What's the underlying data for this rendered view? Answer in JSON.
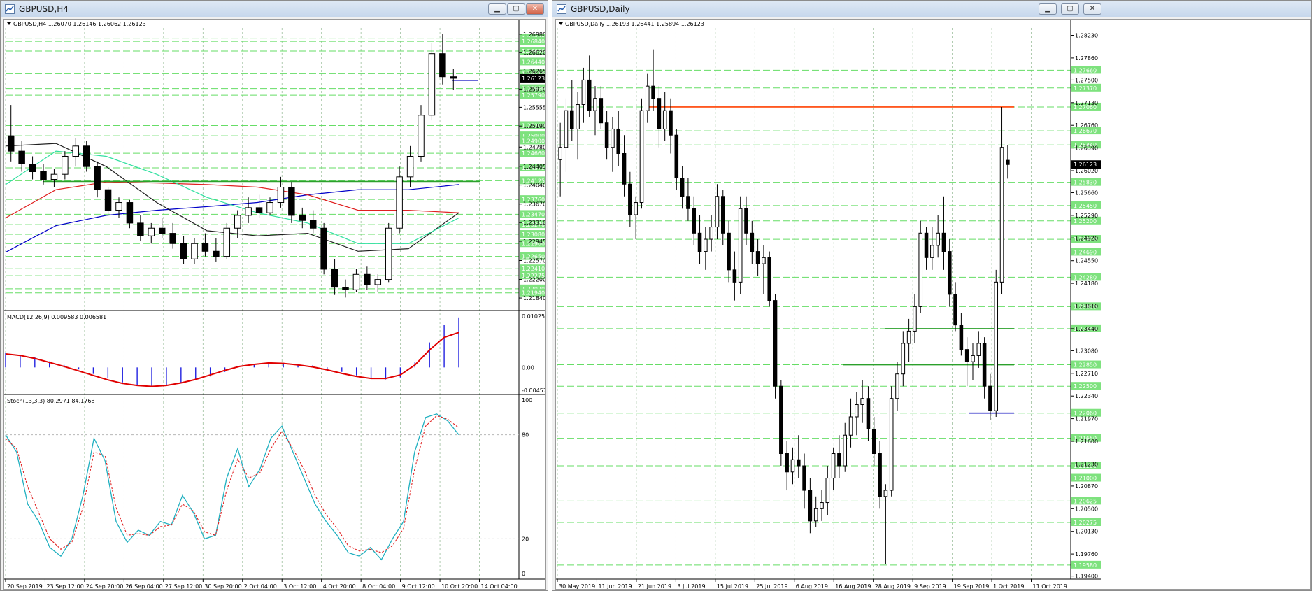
{
  "windows": {
    "h4": {
      "title": "GBPUSD,H4",
      "buttons": [
        "minimize",
        "maximize",
        "close"
      ]
    },
    "daily": {
      "title": "GBPUSD,Daily",
      "buttons": [
        "minimize",
        "maximize",
        "close"
      ]
    }
  },
  "chart_data": [
    {
      "id": "h4",
      "type": "candlestick",
      "symbol": "GBPUSD",
      "timeframe": "H4",
      "header": "GBPUSD,H4  1.26070 1.26146 1.26062 1.26123",
      "ohlc_last": [
        1.2607,
        1.26146,
        1.26062,
        1.26123
      ],
      "ylim": [
        1.2165,
        1.271
      ],
      "ytick_labels": [
        "1.26980",
        "1.26620",
        "1.26265",
        "1.25910",
        "1.25555",
        "1.25190",
        "1.24780",
        "1.24405",
        "1.24040",
        "1.23670",
        "1.23310",
        "1.22945",
        "1.22570",
        "1.22200",
        "1.21840"
      ],
      "level_labels": [
        "1.26900",
        "1.26840",
        "1.26650",
        "1.26440",
        "1.26210",
        "1.25920",
        "1.25790",
        "1.25200",
        "1.25000",
        "1.24900",
        "1.24660",
        "1.24375",
        "1.24125",
        "1.23760",
        "1.23470",
        "1.23270",
        "1.23080",
        "1.22900",
        "1.22650",
        "1.22410",
        "1.22275",
        "1.22020",
        "1.21940"
      ],
      "current_price_label": "1.26123",
      "x_labels": [
        "20 Sep 2019",
        "23 Sep 12:00",
        "24 Sep 20:00",
        "26 Sep 04:00",
        "27 Sep 12:00",
        "30 Sep 20:00",
        "2 Oct 04:00",
        "3 Oct 12:00",
        "4 Oct 20:00",
        "8 Oct 04:00",
        "9 Oct 12:00",
        "10 Oct 20:00",
        "14 Oct 04:00"
      ],
      "horizontal_lines": [
        {
          "price": 1.2411,
          "color": "#2ca02c"
        },
        {
          "price": 1.2608,
          "color": "#1010c0"
        }
      ],
      "moving_averages": [
        {
          "color": "#0000c8",
          "values": [
            1.2273,
            1.2325,
            1.2345,
            1.2355,
            1.2362,
            1.237,
            1.2385,
            1.2395,
            1.2395,
            1.2405
          ]
        },
        {
          "color": "#e02020",
          "values": [
            1.234,
            1.2395,
            1.241,
            1.2408,
            1.2405,
            1.24,
            1.2385,
            1.2355,
            1.2355,
            1.235
          ]
        },
        {
          "color": "#202020",
          "values": [
            1.248,
            1.2485,
            1.244,
            1.237,
            1.2315,
            1.2305,
            1.231,
            1.2275,
            1.228,
            1.235
          ]
        },
        {
          "color": "#30e0a0",
          "values": [
            1.2405,
            1.247,
            1.246,
            1.2425,
            1.238,
            1.235,
            1.233,
            1.229,
            1.229,
            1.234
          ]
        }
      ],
      "macd": {
        "label": "MACD(12,26,9) 0.009583 0.006581",
        "ytick_labels": [
          "0.010257",
          "0.00",
          "-0.00457"
        ],
        "ylim": [
          -0.00457,
          0.010257
        ],
        "histogram": [
          0.0029,
          0.0025,
          0.002,
          0.0012,
          0.0005,
          -0.0004,
          -0.0013,
          -0.0022,
          -0.003,
          -0.0036,
          -0.0038,
          -0.0036,
          -0.0032,
          -0.0026,
          -0.0018,
          -0.0009,
          0.0,
          0.0005,
          0.0009,
          0.0009,
          0.0007,
          0.0004,
          -0.0002,
          -0.0009,
          -0.0016,
          -0.0022,
          -0.0024,
          -0.002,
          0.001,
          0.005,
          0.0085,
          0.01
        ],
        "signal": [
          0.0027,
          0.0024,
          0.0018,
          0.001,
          0.0002,
          -0.0007,
          -0.0016,
          -0.0025,
          -0.0032,
          -0.0036,
          -0.0038,
          -0.0036,
          -0.0031,
          -0.0024,
          -0.0015,
          -0.0006,
          0.0002,
          0.0006,
          0.0009,
          0.0008,
          0.0005,
          0.0001,
          -0.0005,
          -0.0012,
          -0.0018,
          -0.0022,
          -0.0022,
          -0.0015,
          0.0005,
          0.0035,
          0.006,
          0.007
        ]
      },
      "stochastic": {
        "label": "Stoch(13,3,3) 80.2971 84.1768",
        "ytick_labels": [
          "100",
          "80",
          "20",
          "0"
        ],
        "ylim": [
          0,
          100
        ],
        "k": [
          80,
          70,
          40,
          30,
          15,
          10,
          20,
          45,
          78,
          65,
          30,
          18,
          25,
          22,
          30,
          28,
          45,
          35,
          20,
          22,
          55,
          72,
          50,
          60,
          78,
          85,
          70,
          55,
          40,
          30,
          22,
          12,
          10,
          15,
          8,
          20,
          30,
          70,
          90,
          92,
          88,
          80
        ],
        "d": [
          78,
          72,
          50,
          35,
          20,
          14,
          18,
          38,
          70,
          68,
          38,
          22,
          23,
          22,
          27,
          28,
          40,
          36,
          24,
          22,
          48,
          66,
          55,
          58,
          72,
          82,
          72,
          60,
          45,
          34,
          26,
          16,
          13,
          14,
          12,
          16,
          26,
          60,
          85,
          91,
          89,
          84
        ]
      },
      "ohlc": [
        [
          1.25,
          1.256,
          1.245,
          1.247
        ],
        [
          1.247,
          1.249,
          1.243,
          1.2445
        ],
        [
          1.2445,
          1.246,
          1.2415,
          1.243
        ],
        [
          1.243,
          1.2445,
          1.2405,
          1.2415
        ],
        [
          1.2415,
          1.2435,
          1.24,
          1.2425
        ],
        [
          1.2425,
          1.247,
          1.2415,
          1.246
        ],
        [
          1.246,
          1.2495,
          1.244,
          1.248
        ],
        [
          1.248,
          1.249,
          1.243,
          1.244
        ],
        [
          1.244,
          1.245,
          1.238,
          1.2395
        ],
        [
          1.2395,
          1.24,
          1.2345,
          1.2355
        ],
        [
          1.2355,
          1.238,
          1.234,
          1.237
        ],
        [
          1.237,
          1.2375,
          1.232,
          1.233
        ],
        [
          1.233,
          1.2345,
          1.2295,
          1.2305
        ],
        [
          1.2305,
          1.233,
          1.229,
          1.232
        ],
        [
          1.232,
          1.234,
          1.23,
          1.231
        ],
        [
          1.231,
          1.233,
          1.228,
          1.229
        ],
        [
          1.229,
          1.2305,
          1.225,
          1.226
        ],
        [
          1.226,
          1.23,
          1.225,
          1.229
        ],
        [
          1.229,
          1.231,
          1.2265,
          1.2275
        ],
        [
          1.2275,
          1.23,
          1.2255,
          1.2265
        ],
        [
          1.2265,
          1.233,
          1.226,
          1.232
        ],
        [
          1.232,
          1.2355,
          1.23,
          1.2345
        ],
        [
          1.2345,
          1.238,
          1.233,
          1.236
        ],
        [
          1.236,
          1.2385,
          1.234,
          1.235
        ],
        [
          1.235,
          1.238,
          1.2345,
          1.237
        ],
        [
          1.237,
          1.242,
          1.236,
          1.24
        ],
        [
          1.24,
          1.241,
          1.233,
          1.2345
        ],
        [
          1.2345,
          1.236,
          1.232,
          1.2335
        ],
        [
          1.2335,
          1.2355,
          1.231,
          1.232
        ],
        [
          1.232,
          1.233,
          1.223,
          1.224
        ],
        [
          1.224,
          1.226,
          1.219,
          1.2205
        ],
        [
          1.2205,
          1.222,
          1.2185,
          1.22
        ],
        [
          1.22,
          1.224,
          1.2195,
          1.223
        ],
        [
          1.223,
          1.2245,
          1.22,
          1.221
        ],
        [
          1.221,
          1.223,
          1.2195,
          1.222
        ],
        [
          1.222,
          1.233,
          1.2215,
          1.232
        ],
        [
          1.232,
          1.244,
          1.231,
          1.242
        ],
        [
          1.242,
          1.248,
          1.24,
          1.246
        ],
        [
          1.246,
          1.256,
          1.245,
          1.254
        ],
        [
          1.254,
          1.268,
          1.253,
          1.266
        ],
        [
          1.266,
          1.2698,
          1.26,
          1.2615
        ],
        [
          1.2615,
          1.263,
          1.259,
          1.2612
        ]
      ]
    },
    {
      "id": "daily",
      "type": "candlestick",
      "symbol": "GBPUSD",
      "timeframe": "Daily",
      "header": "GBPUSD,Daily  1.26193 1.26441 1.25894 1.26123",
      "ohlc_last": [
        1.26193,
        1.26441,
        1.25894,
        1.26123
      ],
      "ylim": [
        1.1935,
        1.2835
      ],
      "ytick_labels": [
        "1.28230",
        "1.27860",
        "1.27500",
        "1.27130",
        "1.26760",
        "1.26390",
        "1.26020",
        "1.25660",
        "1.25290",
        "1.24920",
        "1.24550",
        "1.24180",
        "1.23810",
        "1.23440",
        "1.23080",
        "1.22710",
        "1.22340",
        "1.21970",
        "1.21600",
        "1.21230",
        "1.20870",
        "1.20500",
        "1.20130",
        "1.19760",
        "1.19400"
      ],
      "level_labels": [
        "1.27660",
        "1.27370",
        "1.27060",
        "1.26670",
        "1.26440",
        "1.25830",
        "1.25450",
        "1.25200",
        "1.24900",
        "1.24690",
        "1.24280",
        "1.23800",
        "1.23440",
        "1.22850",
        "1.22500",
        "1.22060",
        "1.21650",
        "1.21200",
        "1.21000",
        "1.20625",
        "1.20275",
        "1.19580"
      ],
      "current_price_label": "1.26123",
      "x_labels": [
        "30 May 2019",
        "11 Jun 2019",
        "21 Jun 2019",
        "3 Jul 2019",
        "15 Jul 2019",
        "25 Jul 2019",
        "6 Aug 2019",
        "16 Aug 2019",
        "28 Aug 2019",
        "9 Sep 2019",
        "19 Sep 2019",
        "1 Oct 2019",
        "11 Oct 2019"
      ],
      "horizontal_lines": [
        {
          "price": 1.2706,
          "color": "#ff4000"
        },
        {
          "price": 1.2344,
          "color": "#2ca02c"
        },
        {
          "price": 1.2285,
          "color": "#2ca02c"
        },
        {
          "price": 1.2206,
          "color": "#1010c0"
        }
      ],
      "ohlc": [
        [
          1.262,
          1.268,
          1.256,
          1.264
        ],
        [
          1.264,
          1.272,
          1.26,
          1.27
        ],
        [
          1.27,
          1.275,
          1.265,
          1.267
        ],
        [
          1.267,
          1.273,
          1.262,
          1.271
        ],
        [
          1.271,
          1.277,
          1.268,
          1.275
        ],
        [
          1.275,
          1.279,
          1.269,
          1.27
        ],
        [
          1.27,
          1.274,
          1.266,
          1.272
        ],
        [
          1.272,
          1.274,
          1.267,
          1.268
        ],
        [
          1.268,
          1.27,
          1.262,
          1.264
        ],
        [
          1.264,
          1.269,
          1.26,
          1.267
        ],
        [
          1.267,
          1.27,
          1.261,
          1.263
        ],
        [
          1.263,
          1.266,
          1.256,
          1.258
        ],
        [
          1.258,
          1.26,
          1.251,
          1.253
        ],
        [
          1.253,
          1.256,
          1.249,
          1.255
        ],
        [
          1.255,
          1.272,
          1.254,
          1.27
        ],
        [
          1.27,
          1.276,
          1.268,
          1.274
        ],
        [
          1.274,
          1.28,
          1.27,
          1.272
        ],
        [
          1.272,
          1.274,
          1.264,
          1.267
        ],
        [
          1.267,
          1.273,
          1.265,
          1.27
        ],
        [
          1.27,
          1.272,
          1.263,
          1.266
        ],
        [
          1.266,
          1.267,
          1.257,
          1.259
        ],
        [
          1.259,
          1.261,
          1.254,
          1.256
        ],
        [
          1.256,
          1.259,
          1.252,
          1.254
        ],
        [
          1.254,
          1.256,
          1.248,
          1.25
        ],
        [
          1.25,
          1.253,
          1.245,
          1.247
        ],
        [
          1.247,
          1.251,
          1.244,
          1.249
        ],
        [
          1.249,
          1.253,
          1.247,
          1.251
        ],
        [
          1.251,
          1.258,
          1.249,
          1.256
        ],
        [
          1.256,
          1.257,
          1.248,
          1.25
        ],
        [
          1.25,
          1.252,
          1.242,
          1.244
        ],
        [
          1.244,
          1.247,
          1.239,
          1.242
        ],
        [
          1.242,
          1.256,
          1.24,
          1.254
        ],
        [
          1.254,
          1.256,
          1.248,
          1.25
        ],
        [
          1.25,
          1.252,
          1.245,
          1.247
        ],
        [
          1.247,
          1.249,
          1.243,
          1.245
        ],
        [
          1.245,
          1.248,
          1.24,
          1.246
        ],
        [
          1.246,
          1.247,
          1.238,
          1.239
        ],
        [
          1.239,
          1.24,
          1.223,
          1.225
        ],
        [
          1.225,
          1.226,
          1.212,
          1.214
        ],
        [
          1.214,
          1.216,
          1.208,
          1.211
        ],
        [
          1.211,
          1.215,
          1.209,
          1.213
        ],
        [
          1.213,
          1.217,
          1.21,
          1.212
        ],
        [
          1.212,
          1.214,
          1.205,
          1.208
        ],
        [
          1.208,
          1.21,
          1.201,
          1.203
        ],
        [
          1.203,
          1.207,
          1.202,
          1.205
        ],
        [
          1.205,
          1.208,
          1.203,
          1.206
        ],
        [
          1.206,
          1.212,
          1.204,
          1.21
        ],
        [
          1.21,
          1.215,
          1.208,
          1.214
        ],
        [
          1.214,
          1.217,
          1.21,
          1.212
        ],
        [
          1.212,
          1.219,
          1.211,
          1.217
        ],
        [
          1.217,
          1.223,
          1.215,
          1.22
        ],
        [
          1.22,
          1.224,
          1.217,
          1.222
        ],
        [
          1.222,
          1.226,
          1.219,
          1.223
        ],
        [
          1.223,
          1.225,
          1.216,
          1.218
        ],
        [
          1.218,
          1.22,
          1.212,
          1.214
        ],
        [
          1.214,
          1.216,
          1.205,
          1.207
        ],
        [
          1.207,
          1.209,
          1.196,
          1.208
        ],
        [
          1.208,
          1.225,
          1.207,
          1.223
        ],
        [
          1.223,
          1.229,
          1.221,
          1.227
        ],
        [
          1.227,
          1.234,
          1.225,
          1.232
        ],
        [
          1.232,
          1.236,
          1.229,
          1.234
        ],
        [
          1.234,
          1.24,
          1.232,
          1.238
        ],
        [
          1.238,
          1.252,
          1.237,
          1.25
        ],
        [
          1.25,
          1.251,
          1.244,
          1.246
        ],
        [
          1.246,
          1.251,
          1.244,
          1.248
        ],
        [
          1.248,
          1.253,
          1.246,
          1.25
        ],
        [
          1.25,
          1.256,
          1.244,
          1.247
        ],
        [
          1.247,
          1.249,
          1.238,
          1.24
        ],
        [
          1.24,
          1.242,
          1.234,
          1.235
        ],
        [
          1.235,
          1.237,
          1.23,
          1.231
        ],
        [
          1.231,
          1.233,
          1.225,
          1.229
        ],
        [
          1.229,
          1.232,
          1.226,
          1.23
        ],
        [
          1.23,
          1.234,
          1.228,
          1.232
        ],
        [
          1.232,
          1.233,
          1.223,
          1.225
        ],
        [
          1.225,
          1.227,
          1.2195,
          1.221
        ],
        [
          1.221,
          1.244,
          1.22,
          1.242
        ],
        [
          1.242,
          1.2706,
          1.24,
          1.264
        ],
        [
          1.2619,
          1.2644,
          1.2589,
          1.2612
        ]
      ]
    }
  ]
}
